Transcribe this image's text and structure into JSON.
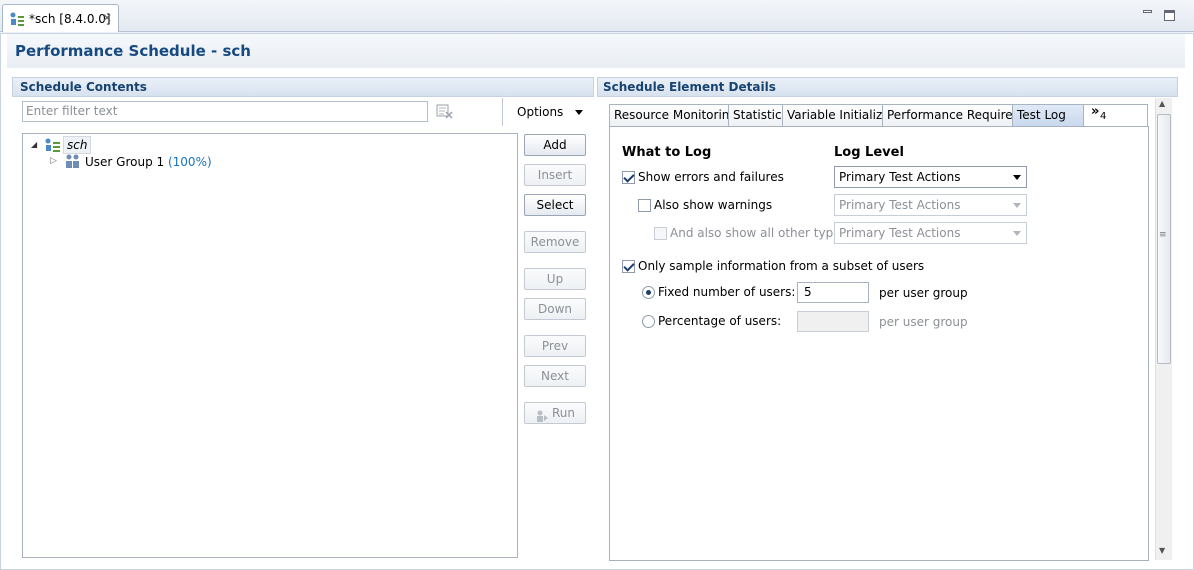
{
  "editor_tab": {
    "label": "*sch [8.4.0.0]"
  },
  "form": {
    "title": "Performance Schedule - sch"
  },
  "schedule_contents": {
    "title": "Schedule Contents",
    "filter_placeholder": "Enter filter text",
    "options_label": "Options",
    "tree": {
      "root": "sch",
      "children": [
        {
          "label": "User Group 1",
          "percent": "(100%)"
        }
      ]
    },
    "buttons": {
      "add": "Add",
      "insert": "Insert",
      "select": "Select",
      "remove": "Remove",
      "up": "Up",
      "down": "Down",
      "prev": "Prev",
      "next": "Next",
      "run": "Run"
    }
  },
  "details": {
    "title": "Schedule Element Details",
    "tabs": [
      "Resource Monitoring",
      "Statistics",
      "Variable Initializat",
      "Performance Requirem",
      "Test Log"
    ],
    "overflow": {
      "chevron": "»",
      "count": "4"
    },
    "what_to_log": "What to Log",
    "log_level": "Log Level",
    "show_errors": "Show errors and failures",
    "also_warnings": "Also show warnings",
    "also_all": "And also show all other types",
    "level_value": "Primary Test Actions",
    "sample_label": "Only sample information from a subset of users",
    "fixed_label": "Fixed number of users:",
    "fixed_value": "5",
    "percentage_label": "Percentage of users:",
    "per_group": "per user group"
  },
  "colors": {
    "title_blue": "#174a80",
    "section_blue": "#19436f",
    "percent_blue": "#1a73b8"
  }
}
